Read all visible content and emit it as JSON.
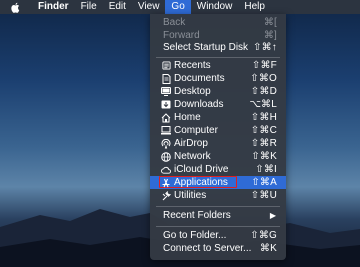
{
  "menubar": {
    "items": [
      "Finder",
      "File",
      "Edit",
      "View",
      "Go",
      "Window",
      "Help"
    ],
    "active": "Go"
  },
  "go_menu": {
    "history": [
      {
        "label": "Back",
        "shortcut": "⌘[",
        "disabled": true
      },
      {
        "label": "Forward",
        "shortcut": "⌘]",
        "disabled": true
      },
      {
        "label": "Select Startup Disk",
        "shortcut": "⇧⌘↑",
        "disabled": false
      }
    ],
    "places": [
      {
        "label": "Recents",
        "shortcut": "⇧⌘F",
        "icon": "recents-icon"
      },
      {
        "label": "Documents",
        "shortcut": "⇧⌘O",
        "icon": "documents-icon"
      },
      {
        "label": "Desktop",
        "shortcut": "⇧⌘D",
        "icon": "desktop-icon"
      },
      {
        "label": "Downloads",
        "shortcut": "⌥⌘L",
        "icon": "downloads-icon"
      },
      {
        "label": "Home",
        "shortcut": "⇧⌘H",
        "icon": "home-icon"
      },
      {
        "label": "Computer",
        "shortcut": "⇧⌘C",
        "icon": "computer-icon"
      },
      {
        "label": "AirDrop",
        "shortcut": "⇧⌘R",
        "icon": "airdrop-icon"
      },
      {
        "label": "Network",
        "shortcut": "⇧⌘K",
        "icon": "network-icon"
      },
      {
        "label": "iCloud Drive",
        "shortcut": "⇧⌘I",
        "icon": "icloud-icon"
      },
      {
        "label": "Applications",
        "shortcut": "⇧⌘A",
        "icon": "applications-icon",
        "selected": true
      },
      {
        "label": "Utilities",
        "shortcut": "⇧⌘U",
        "icon": "utilities-icon"
      }
    ],
    "recent_folders": {
      "label": "Recent Folders"
    },
    "server": [
      {
        "label": "Go to Folder...",
        "shortcut": "⇧⌘G"
      },
      {
        "label": "Connect to Server...",
        "shortcut": "⌘K"
      }
    ]
  },
  "colors": {
    "menubar": "#2c3440",
    "menu": "#343a44",
    "highlight": "#2f6bd6",
    "annotation": "#e02020"
  }
}
